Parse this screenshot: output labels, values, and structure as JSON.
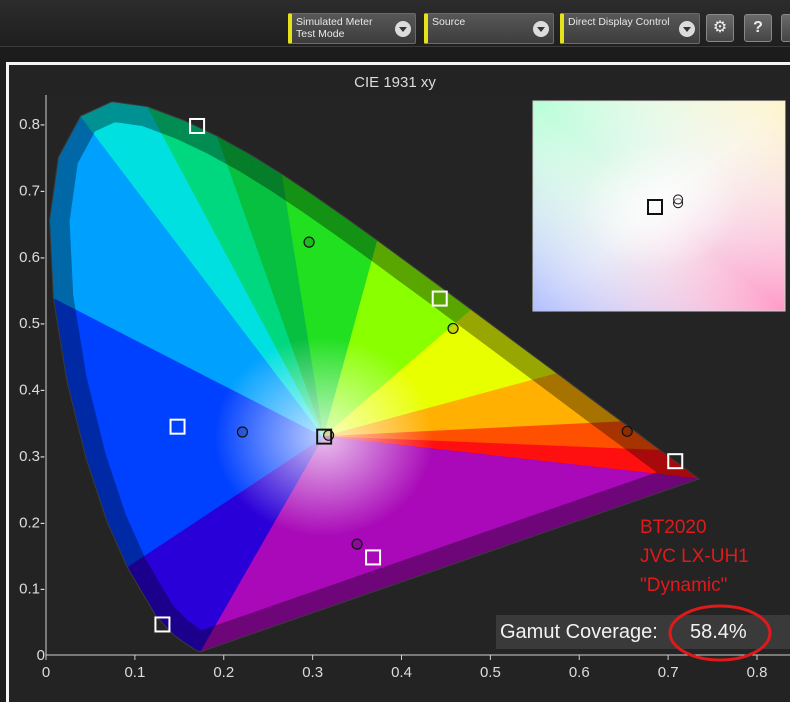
{
  "toolbar": {
    "meter_line1": "Simulated Meter",
    "meter_line2": "Test Mode",
    "source_label": "Source",
    "display_label": "Direct Display Control",
    "settings_icon": "gear-icon",
    "help_label": "?",
    "accent_color": "#e6e21a"
  },
  "annotation": {
    "line1": "BT2020",
    "line2": "JVC LX-UH1",
    "line3": "\"Dynamic\"",
    "color": "#e0191b"
  },
  "gamut": {
    "label": "Gamut Coverage:",
    "value": "58.4%"
  },
  "chart_data": {
    "type": "scatter",
    "title": "CIE 1931 xy",
    "xlim": [
      0,
      0.8
    ],
    "ylim": [
      0,
      0.84
    ],
    "x_ticks": [
      "0",
      "0.1",
      "0.2",
      "0.3",
      "0.4",
      "0.5",
      "0.6",
      "0.7",
      "0.8"
    ],
    "y_ticks": [
      "0",
      "0.1-",
      "0.2-",
      "0.3-",
      "0.4-",
      "0.5-",
      "0.6-",
      "0.7-",
      "0.8-"
    ],
    "spectral_locus": [
      [
        0.1741,
        0.005
      ],
      [
        0.1699,
        0.0062
      ],
      [
        0.1566,
        0.0177
      ],
      [
        0.144,
        0.0297
      ],
      [
        0.1241,
        0.0578
      ],
      [
        0.0913,
        0.1327
      ],
      [
        0.0687,
        0.2007
      ],
      [
        0.0454,
        0.295
      ],
      [
        0.0235,
        0.4127
      ],
      [
        0.0082,
        0.5384
      ],
      [
        0.0039,
        0.6548
      ],
      [
        0.0139,
        0.7502
      ],
      [
        0.0389,
        0.812
      ],
      [
        0.0743,
        0.8338
      ],
      [
        0.1142,
        0.8262
      ],
      [
        0.1547,
        0.8059
      ],
      [
        0.1929,
        0.7816
      ],
      [
        0.2296,
        0.7543
      ],
      [
        0.2658,
        0.7243
      ],
      [
        0.3016,
        0.6923
      ],
      [
        0.3373,
        0.6589
      ],
      [
        0.3731,
        0.6245
      ],
      [
        0.4087,
        0.5896
      ],
      [
        0.4441,
        0.5547
      ],
      [
        0.4788,
        0.5202
      ],
      [
        0.5125,
        0.4866
      ],
      [
        0.5448,
        0.4544
      ],
      [
        0.5752,
        0.4242
      ],
      [
        0.6029,
        0.3965
      ],
      [
        0.627,
        0.3725
      ],
      [
        0.6482,
        0.3514
      ],
      [
        0.6658,
        0.334
      ],
      [
        0.6801,
        0.3197
      ],
      [
        0.6915,
        0.3083
      ],
      [
        0.7006,
        0.2993
      ],
      [
        0.7079,
        0.292
      ],
      [
        0.714,
        0.2859
      ],
      [
        0.7347,
        0.2653
      ]
    ],
    "series": [
      {
        "name": "",
        "points": [
          {
            "x": 0.17,
            "y": 0.797
          },
          {
            "x": 0.708,
            "y": 0.292
          },
          {
            "x": 0.131,
            "y": 0.046
          },
          {
            "x": 0.443,
            "y": 0.537
          },
          {
            "x": 0.148,
            "y": 0.344
          },
          {
            "x": 0.368,
            "y": 0.147
          },
          {
            "x": 0.313,
            "y": 0.329
          }
        ]
      },
      {
        "name": "",
        "points": [
          {
            "x": 0.296,
            "y": 0.622
          },
          {
            "x": 0.458,
            "y": 0.492
          },
          {
            "x": 0.654,
            "y": 0.337
          },
          {
            "x": 0.221,
            "y": 0.336
          },
          {
            "x": 0.35,
            "y": 0.167
          },
          {
            "x": 0.318,
            "y": 0.331
          }
        ]
      }
    ],
    "inset": {
      "target": {
        "x": 0.3127,
        "y": 0.329
      },
      "measured": [
        {
          "x": 0.318,
          "y": 0.331
        },
        {
          "x": 0.318,
          "y": 0.333
        }
      ]
    }
  }
}
